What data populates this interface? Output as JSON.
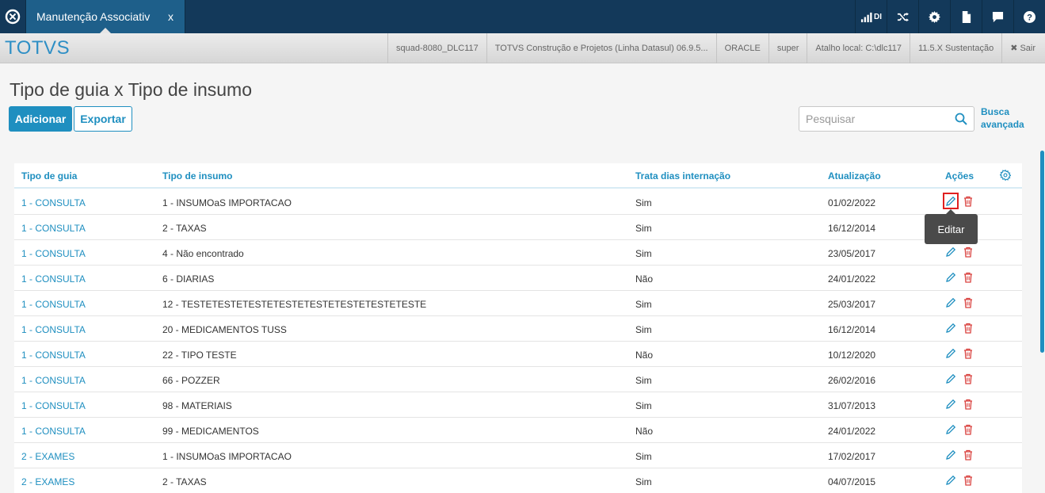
{
  "topbar": {
    "tab_label": "Manutenção Associativ",
    "tab_close": "x",
    "di_label": "DI",
    "colors": {
      "bar": "#13395a",
      "tab": "#1e5f8a"
    }
  },
  "infobar": {
    "brand": "TOTVS",
    "items": [
      "squad-8080_DLC117",
      "TOTVS Construção e Projetos (Linha Datasul) 06.9.5...",
      "ORACLE",
      "super",
      "Atalho local: C:\\dlc117",
      "11.5.X Sustentação"
    ],
    "exit_label": "Sair"
  },
  "page": {
    "title": "Tipo de guia x Tipo de insumo",
    "add_label": "Adicionar",
    "export_label": "Exportar",
    "search_placeholder": "Pesquisar",
    "adv_search_line1": "Busca",
    "adv_search_line2": "avançada",
    "accent_color": "#1f8fc0"
  },
  "table": {
    "headers": [
      "Tipo de guia",
      "Tipo de insumo",
      "Trata dias internação",
      "Atualização",
      "Ações"
    ],
    "rows": [
      [
        "1 - CONSULTA",
        "1 - INSUMOaS IMPORTACAO",
        "Sim",
        "01/02/2022"
      ],
      [
        "1 - CONSULTA",
        "2 - TAXAS",
        "Sim",
        "16/12/2014"
      ],
      [
        "1 - CONSULTA",
        "4 - Não encontrado",
        "Sim",
        "23/05/2017"
      ],
      [
        "1 - CONSULTA",
        "6 - DIARIAS",
        "Não",
        "24/01/2022"
      ],
      [
        "1 - CONSULTA",
        "12 - TESTETESTETESTETESTETESTETESTETESTETESTE",
        "Sim",
        "25/03/2017"
      ],
      [
        "1 - CONSULTA",
        "20 - MEDICAMENTOS TUSS",
        "Sim",
        "16/12/2014"
      ],
      [
        "1 - CONSULTA",
        "22 - TIPO TESTE",
        "Não",
        "10/12/2020"
      ],
      [
        "1 - CONSULTA",
        "66 - POZZER",
        "Sim",
        "26/02/2016"
      ],
      [
        "1 - CONSULTA",
        "98 - MATERIAIS",
        "Sim",
        "31/07/2013"
      ],
      [
        "1 - CONSULTA",
        "99 - MEDICAMENTOS",
        "Não",
        "24/01/2022"
      ],
      [
        "2 - EXAMES",
        "1 - INSUMOaS IMPORTACAO",
        "Sim",
        "17/02/2017"
      ],
      [
        "2 - EXAMES",
        "2 - TAXAS",
        "Sim",
        "04/07/2015"
      ]
    ],
    "tooltip": "Editar"
  }
}
